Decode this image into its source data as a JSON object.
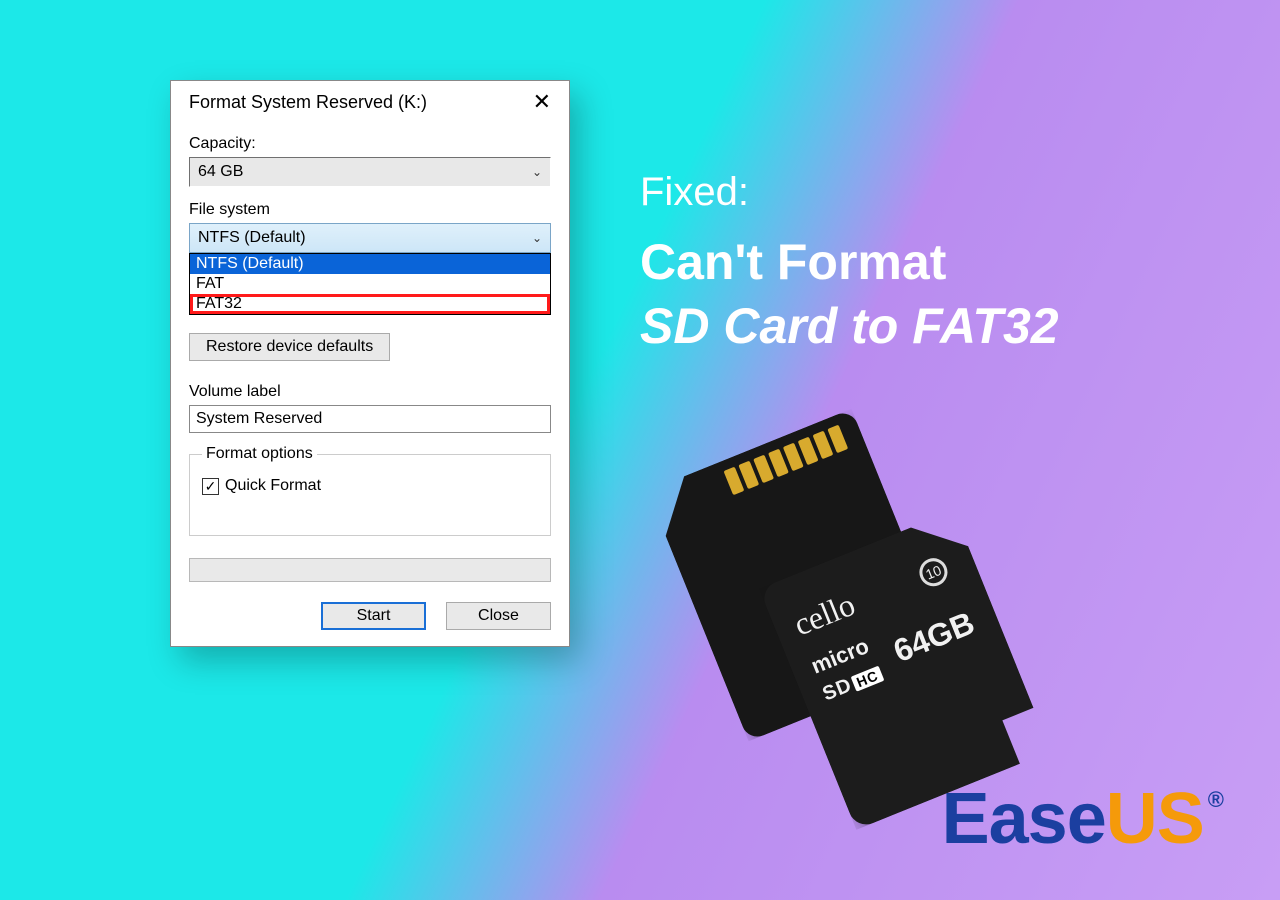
{
  "dialog": {
    "title": "Format System Reserved (K:)",
    "capacity_label": "Capacity:",
    "capacity_value": "64 GB",
    "fs_label": "File system",
    "fs_value": "NTFS (Default)",
    "fs_options": [
      "NTFS (Default)",
      "FAT",
      "FAT32"
    ],
    "restore_btn": "Restore device defaults",
    "volume_label_label": "Volume label",
    "volume_label_value": "System Reserved",
    "format_options_legend": "Format options",
    "quick_format_label": "Quick Format",
    "quick_format_checked": true,
    "start_btn": "Start",
    "close_btn": "Close"
  },
  "headline": {
    "line1": "Fixed:",
    "line2": "Can't Format",
    "line3": "SD Card to FAT32"
  },
  "sdcard": {
    "brand": "cello",
    "class": "10",
    "micro": "micro",
    "sd": "SD",
    "hc": "HC",
    "capacity": "64GB"
  },
  "brand_logo": {
    "ease": "Ease",
    "us": "US",
    "r": "®"
  },
  "icons": {
    "close": "✕",
    "chevron": "⌄",
    "check": "✓"
  }
}
